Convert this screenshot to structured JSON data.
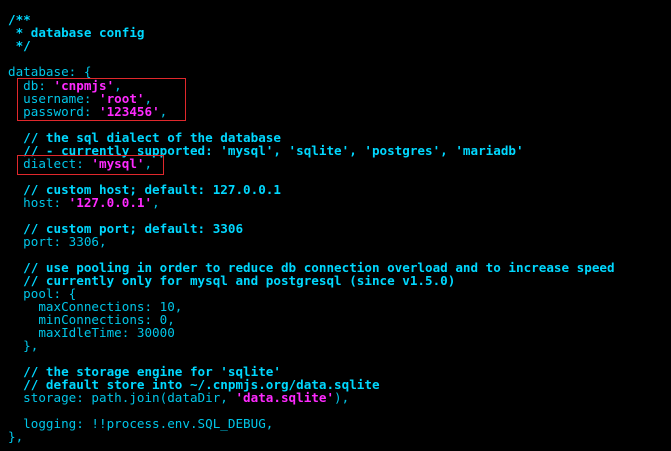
{
  "code": {
    "comment_open": "/**",
    "comment_title": " * database config",
    "comment_close": " */",
    "db_open": "database: {",
    "db_key": "  db: ",
    "db_val": "'cnpmjs'",
    "db_comma": ",",
    "user_key": "  username: ",
    "user_val": "'root'",
    "user_comma": ",",
    "pass_key": "  password: ",
    "pass_val": "'123456'",
    "pass_comma": ",",
    "dialect_comment1": "  // the sql dialect of the database",
    "dialect_comment2": "  // - currently supported: 'mysql', 'sqlite', 'postgres', 'mariadb'",
    "dialect_key": "  dialect: ",
    "dialect_val": "'mysql'",
    "dialect_comma": ",",
    "host_comment": "  // custom host; default: 127.0.0.1",
    "host_key": "  host: ",
    "host_val": "'127.0.0.1'",
    "host_comma": ",",
    "port_comment": "  // custom port; default: 3306",
    "port_line": "  port: 3306,",
    "pool_comment1": "  // use pooling in order to reduce db connection overload and to increase speed",
    "pool_comment2": "  // currently only for mysql and postgresql (since v1.5.0)",
    "pool_open": "  pool: {",
    "pool_max": "    maxConnections: 10,",
    "pool_min": "    minConnections: 0,",
    "pool_idle": "    maxIdleTime: 30000",
    "pool_close": "  },",
    "storage_comment1": "  // the storage engine for 'sqlite'",
    "storage_comment2": "  // default store into ~/.cnpmjs.org/data.sqlite",
    "storage_key": "  storage: path.join(dataDir, ",
    "storage_val": "'data.sqlite'",
    "storage_end": "),",
    "logging_line": "  logging: !!process.env.SQL_DEBUG,",
    "db_close": "},"
  },
  "colors": {
    "background": "#000000",
    "comment": "#00d8ff",
    "keys": "#00c6e8",
    "strings": "#ff2aff",
    "highlight_box": "#e0282c"
  }
}
